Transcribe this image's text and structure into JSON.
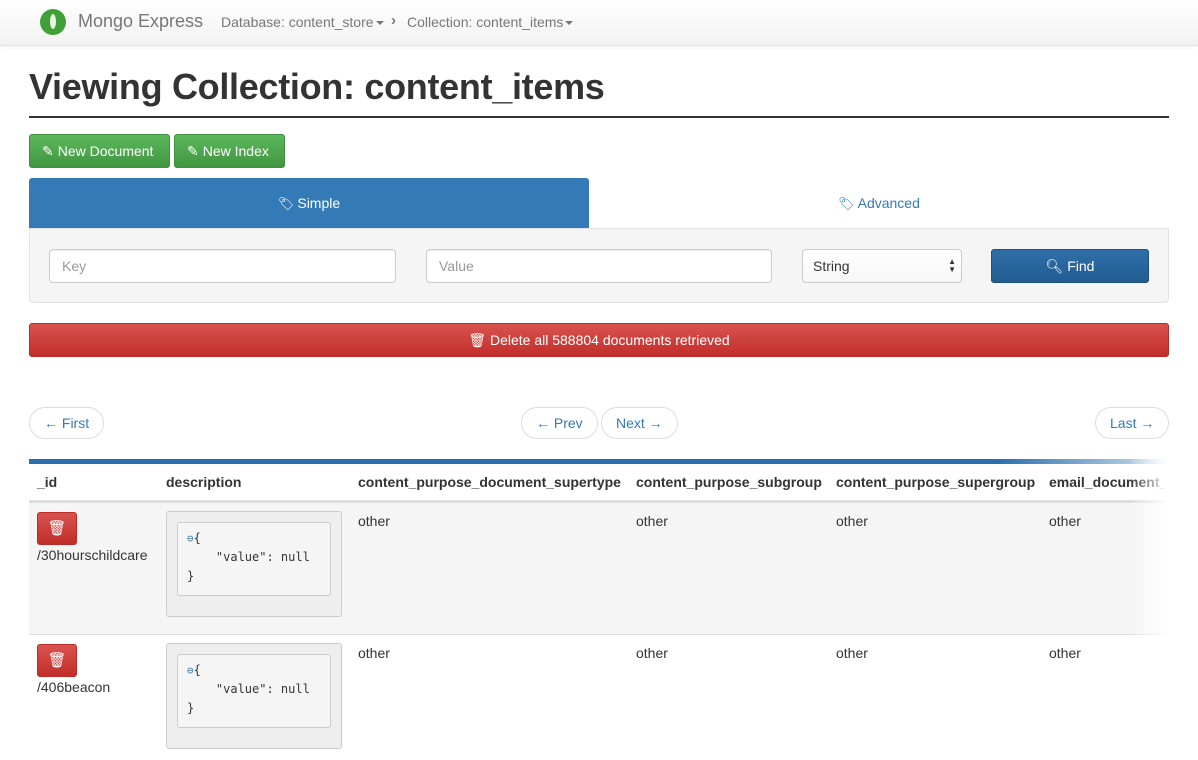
{
  "navbar": {
    "brand": "Mongo Express",
    "database_crumb": "Database: content_store",
    "collection_crumb": "Collection: content_items"
  },
  "page": {
    "title": "Viewing Collection: content_items"
  },
  "actions": {
    "new_document": "New Document",
    "new_index": "New Index"
  },
  "tabs": {
    "simple": "Simple",
    "advanced": "Advanced"
  },
  "search": {
    "key_placeholder": "Key",
    "value_placeholder": "Value",
    "type_selected": "String",
    "find_label": "Find"
  },
  "delete_all_label": "Delete all 588804 documents retrieved",
  "pager": {
    "first": "← First",
    "prev": "← Prev",
    "next": "Next →",
    "last": "Last →"
  },
  "table": {
    "columns": [
      "_id",
      "description",
      "content_purpose_document_supertype",
      "content_purpose_subgroup",
      "content_purpose_supergroup",
      "email_document_"
    ],
    "rows": [
      {
        "id": "/30hourschildcare",
        "description_json": [
          "{",
          "    \"value\": null",
          "}"
        ],
        "supertype": "other",
        "subgroup": "other",
        "supergroup": "other",
        "email_doc": "other"
      },
      {
        "id": "/406beacon",
        "description_json": [
          "{",
          "    \"value\": null",
          "}"
        ],
        "supertype": "other",
        "subgroup": "other",
        "supergroup": "other",
        "email_doc": "other"
      }
    ]
  },
  "colors": {
    "primary": "#337ab7",
    "success": "#5cb85c",
    "danger": "#d9534f",
    "brand_green": "#3fa037"
  },
  "icons": {
    "brand": "leaf-icon",
    "pencil": "pencil-icon",
    "tag": "tag-icon",
    "tags": "tags-icon",
    "search": "search-icon",
    "trash": "trash-icon",
    "collapse": "collapse-icon"
  }
}
